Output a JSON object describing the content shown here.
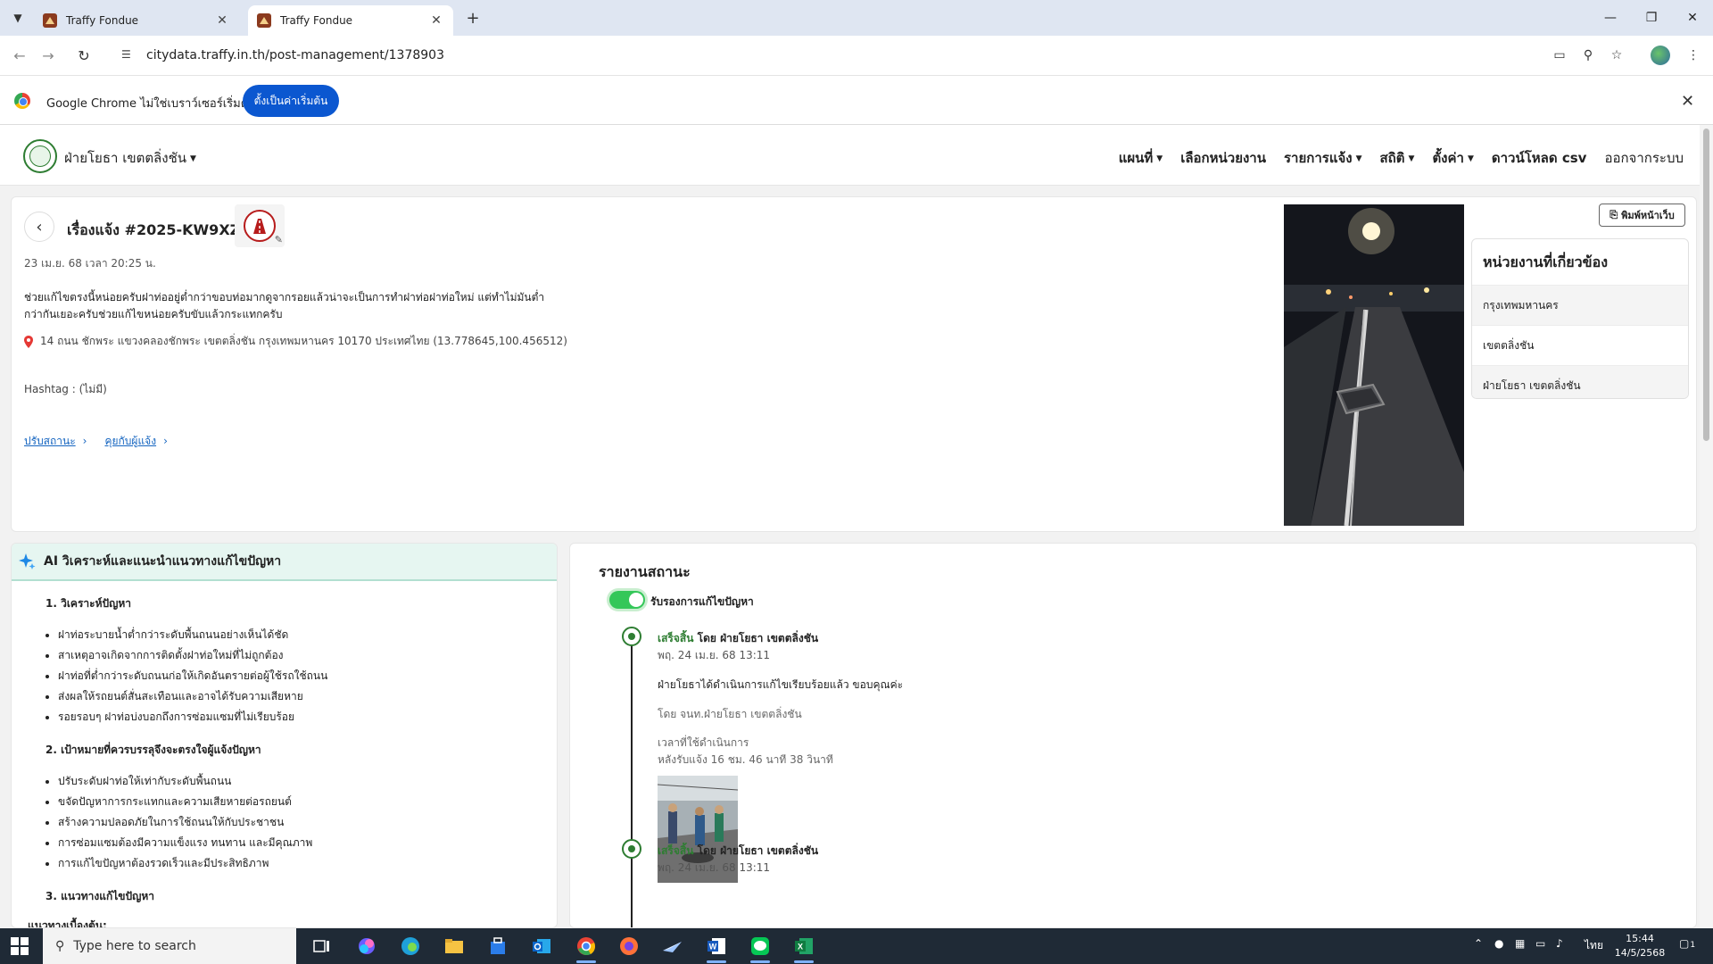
{
  "browser": {
    "tabs": [
      {
        "title": "Traffy Fondue"
      },
      {
        "title": "Traffy Fondue"
      }
    ],
    "url": "citydata.traffy.in.th/post-management/1378903"
  },
  "banner": {
    "message": "Google Chrome ไม่ใช่เบราว์เซอร์เริ่มต้น",
    "button": "ตั้งเป็นค่าเริ่มต้น"
  },
  "nav": {
    "org": "ฝ่ายโยธา เขตตลิ่งชัน",
    "items": [
      "แผนที่",
      "เลือกหน่วยงาน",
      "รายการแจ้ง",
      "สถิติ",
      "ตั้งค่า",
      "ดาวน์โหลด csv",
      "ออกจากระบบ"
    ]
  },
  "report": {
    "title": "เรื่องแจ้ง #2025-KW9XZF",
    "timestamp": "23 เม.ย. 68 เวลา 20:25 น.",
    "description_line1": "ช่วยแก้ไขตรงนี้หน่อยครับฝาท่ออยู่ต่ำกว่าขอบท่อมากดูจากรอยแล้วน่าจะเป็นการทำฝาท่อฝาท่อใหม่ แต่ทำไม่มันต่ำ",
    "description_line2": "กว่ากันเยอะครับช่วยแก้ไขหน่อยครับขับแล้วกระแทกครับ",
    "address": "14 ถนน ชักพระ แขวงคลองชักพระ เขตตลิ่งชัน กรุงเทพมหานคร 10170 ประเทศไทย (13.778645,100.456512)",
    "hashtag": "Hashtag : (ไม่มี)",
    "links": [
      "ปรับสถานะ",
      "คุยกับผู้แจ้ง"
    ],
    "print_button": "พิมพ์หน้าเว็บ"
  },
  "agencies": {
    "title": "หน่วยงานที่เกี่ยวข้อง",
    "items": [
      "กรุงเทพมหานคร",
      "เขตตลิ่งชัน",
      "ฝ่ายโยธา เขตตลิ่งชัน"
    ]
  },
  "ai": {
    "title": "AI วิเคราะห์และแนะนำแนวทางแก้ไขปัญหา",
    "sections": [
      {
        "heading": "1. วิเคราะห์ปัญหา",
        "items": [
          "ฝาท่อระบายน้ำต่ำกว่าระดับพื้นถนนอย่างเห็นได้ชัด",
          "สาเหตุอาจเกิดจากการติดตั้งฝาท่อใหม่ที่ไม่ถูกต้อง",
          "ฝาท่อที่ต่ำกว่าระดับถนนก่อให้เกิดอันตรายต่อผู้ใช้รถใช้ถนน",
          "ส่งผลให้รถยนต์สั่นสะเทือนและอาจได้รับความเสียหาย",
          "รอยรอบๆ ฝาท่อบ่งบอกถึงการซ่อมแซมที่ไม่เรียบร้อย"
        ]
      },
      {
        "heading": "2. เป้าหมายที่ควรบรรลุจึงจะตรงใจผู้แจ้งปัญหา",
        "items": [
          "ปรับระดับฝาท่อให้เท่ากับระดับพื้นถนน",
          "ขจัดปัญหาการกระแทกและความเสียหายต่อรถยนต์",
          "สร้างความปลอดภัยในการใช้ถนนให้กับประชาชน",
          "การซ่อมแซมต้องมีความแข็งแรง ทนทาน และมีคุณภาพ",
          "การแก้ไขปัญหาต้องรวดเร็วและมีประสิทธิภาพ"
        ]
      },
      {
        "heading": "3. แนวทางแก้ไขปัญหา",
        "items": []
      }
    ],
    "trailing": "แนวทางเบื้องต้น:"
  },
  "status": {
    "title": "รายงานสถานะ",
    "toggle_label": "รับรองการแก้ไขปัญหา",
    "entries": [
      {
        "state": "เสร็จสิ้น",
        "by": "โดย ฝ่ายโยธา เขตตลิ่งชัน",
        "date": "พฤ. 24 เม.ย. 68 13:11",
        "text": "ฝ่ายโยธาได้ดำเนินการแก้ไขเรียบร้อยแล้ว ขอบคุณค่ะ",
        "officer": "โดย จนท.ฝ่ายโยธา เขตตลิ่งชัน",
        "duration_label": "เวลาที่ใช้ดำเนินการ",
        "duration": "หลังรับแจ้ง 16 ชม. 46 นาที 38 วินาที"
      },
      {
        "state": "เสร็จสิ้น",
        "by": "โดย ฝ่ายโยธา เขตตลิ่งชัน",
        "date": "พฤ. 24 เม.ย. 68 13:11"
      }
    ]
  },
  "taskbar": {
    "search_placeholder": "Type here to search",
    "lang": "ไทย",
    "time": "15:44",
    "date": "14/5/2568",
    "notifications": "1"
  }
}
